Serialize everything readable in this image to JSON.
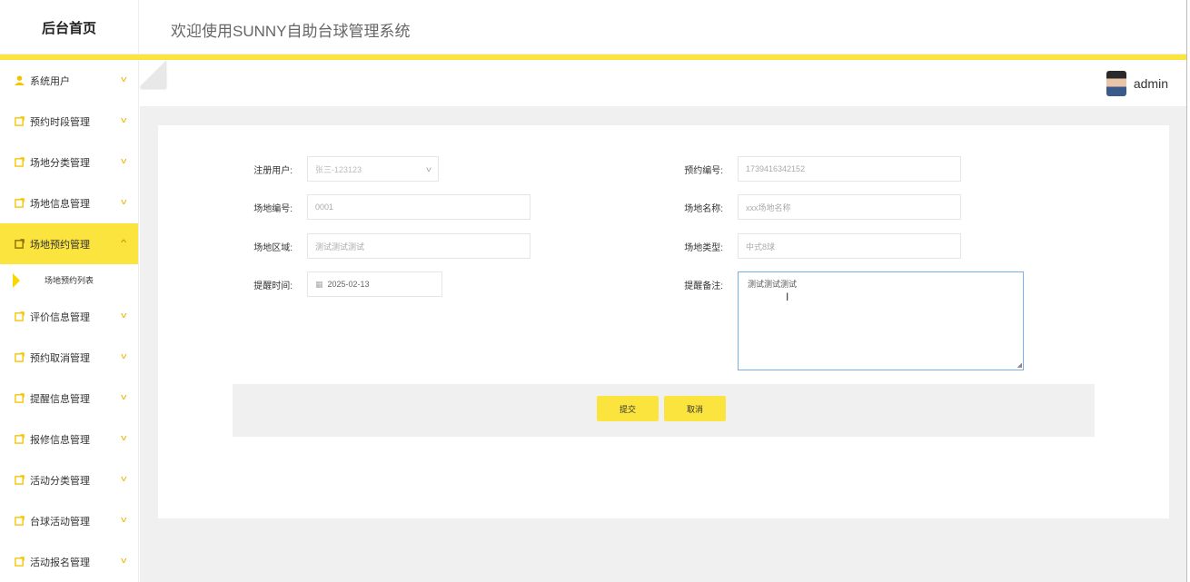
{
  "header": {
    "logo": "后台首页",
    "welcome": "欢迎使用SUNNY自助台球管理系统",
    "username": "admin"
  },
  "sidebar": {
    "items": [
      {
        "label": "系统用户",
        "icon": "user-icon"
      },
      {
        "label": "预约时段管理",
        "icon": "note-icon"
      },
      {
        "label": "场地分类管理",
        "icon": "note-icon"
      },
      {
        "label": "场地信息管理",
        "icon": "note-icon"
      },
      {
        "label": "场地预约管理",
        "icon": "note-icon",
        "active": true
      },
      {
        "label": "评价信息管理",
        "icon": "note-icon"
      },
      {
        "label": "预约取消管理",
        "icon": "note-icon"
      },
      {
        "label": "提醒信息管理",
        "icon": "note-icon"
      },
      {
        "label": "报修信息管理",
        "icon": "note-icon"
      },
      {
        "label": "活动分类管理",
        "icon": "note-icon"
      },
      {
        "label": "台球活动管理",
        "icon": "note-icon"
      },
      {
        "label": "活动报名管理",
        "icon": "note-icon"
      }
    ],
    "sub_item": "场地预约列表"
  },
  "form": {
    "user_label": "注册用户:",
    "user_value": "张三-123123",
    "booking_no_label": "预约编号:",
    "booking_no_value": "1739416342152",
    "venue_no_label": "场地编号:",
    "venue_no_value": "0001",
    "venue_name_label": "场地名称:",
    "venue_name_value": "xxx场地名称",
    "area_label": "场地区域:",
    "area_value": "测试测试测试",
    "type_label": "场地类型:",
    "type_value": "中式8球",
    "remind_time_label": "提醒时间:",
    "remind_time_value": "2025-02-13",
    "remind_note_label": "提醒备注:",
    "remind_note_value": "测试测试测试"
  },
  "buttons": {
    "submit": "提交",
    "cancel": "取消"
  },
  "colors": {
    "accent": "#fbe43d",
    "icon": "#f5c400"
  }
}
